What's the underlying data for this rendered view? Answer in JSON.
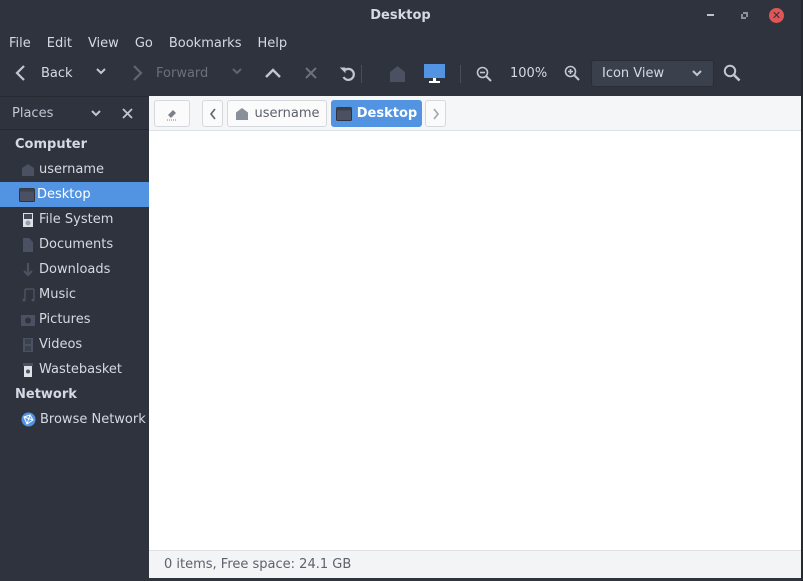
{
  "window": {
    "title": "Desktop",
    "controls": {
      "minimize": "minimize",
      "maximize": "maximize",
      "close": "✕"
    }
  },
  "menubar": {
    "items": [
      {
        "label": "File"
      },
      {
        "label": "Edit"
      },
      {
        "label": "View"
      },
      {
        "label": "Go"
      },
      {
        "label": "Bookmarks"
      },
      {
        "label": "Help"
      }
    ]
  },
  "toolbar": {
    "back_label": "Back",
    "forward_label": "Forward",
    "zoom_level": "100%",
    "view_mode": "Icon View"
  },
  "sidebar": {
    "title": "Places",
    "sections": [
      {
        "label": "Computer",
        "items": [
          {
            "label": "username",
            "icon": "home-icon",
            "active": false
          },
          {
            "label": "Desktop",
            "icon": "desktop-icon",
            "active": true
          },
          {
            "label": "File System",
            "icon": "drive-icon",
            "active": false
          },
          {
            "label": "Documents",
            "icon": "documents-icon",
            "active": false
          },
          {
            "label": "Downloads",
            "icon": "download-icon",
            "active": false
          },
          {
            "label": "Music",
            "icon": "music-icon",
            "active": false
          },
          {
            "label": "Pictures",
            "icon": "camera-icon",
            "active": false
          },
          {
            "label": "Videos",
            "icon": "video-icon",
            "active": false
          },
          {
            "label": "Wastebasket",
            "icon": "trash-icon",
            "active": false
          }
        ]
      },
      {
        "label": "Network",
        "items": [
          {
            "label": "Browse Network",
            "icon": "network-icon",
            "active": false
          }
        ]
      }
    ]
  },
  "pathbar": {
    "crumbs": [
      {
        "label": "username",
        "icon": "home-icon",
        "active": false
      },
      {
        "label": "Desktop",
        "icon": "desktop-icon",
        "active": true
      }
    ]
  },
  "status": {
    "text": "0 items, Free space: 24.1 GB"
  },
  "colors": {
    "accent": "#5294e2",
    "close": "#e05555",
    "chrome_bg": "#2f333d",
    "content_bg": "#ffffff"
  }
}
